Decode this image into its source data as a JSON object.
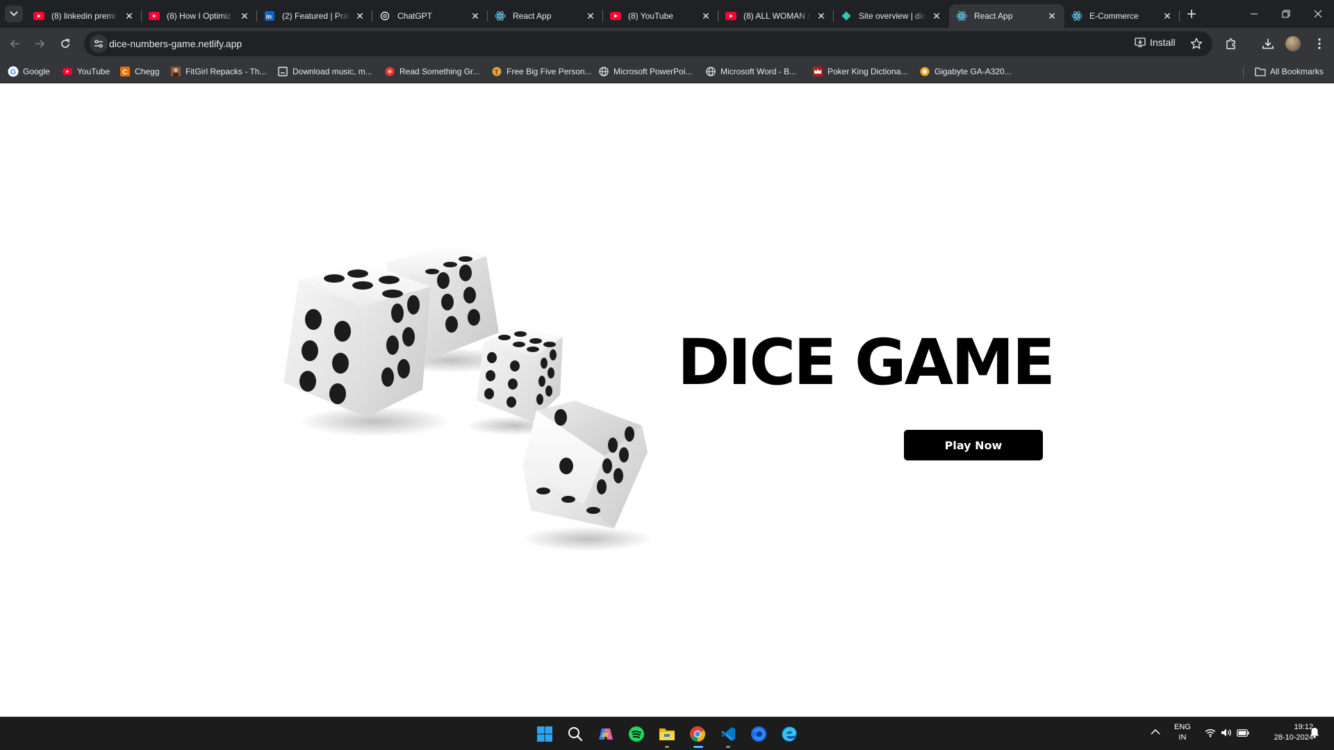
{
  "browser": {
    "tabs": [
      {
        "title": "(8) linkedin premi",
        "favicon": "youtube-icon"
      },
      {
        "title": "(8) How I Optimiz",
        "favicon": "youtube-icon"
      },
      {
        "title": "(2) Featured | Prat",
        "favicon": "linkedin-icon"
      },
      {
        "title": "ChatGPT",
        "favicon": "chatgpt-icon"
      },
      {
        "title": "React App",
        "favicon": "react-icon"
      },
      {
        "title": "(8) YouTube",
        "favicon": "youtube-icon"
      },
      {
        "title": "(8) ALL WOMAN /",
        "favicon": "youtube-icon"
      },
      {
        "title": "Site overview | dic",
        "favicon": "netlify-icon"
      },
      {
        "title": "React App",
        "favicon": "react-icon",
        "active": true
      },
      {
        "title": "E-Commerce",
        "favicon": "react-icon"
      }
    ],
    "url": "dice-numbers-game.netlify.app",
    "install_label": "Install",
    "bookmarks": [
      {
        "label": "Google",
        "icon": "google-icon"
      },
      {
        "label": "YouTube",
        "icon": "youtube-icon"
      },
      {
        "label": "Chegg",
        "icon": "chegg-icon"
      },
      {
        "label": "FitGirl Repacks - Th...",
        "icon": "fitgirl-icon"
      },
      {
        "label": "Download music, m...",
        "icon": "download-site-icon"
      },
      {
        "label": "Read Something Gr...",
        "icon": "read-site-icon"
      },
      {
        "label": "Free Big Five Person...",
        "icon": "test-site-icon"
      },
      {
        "label": "Microsoft PowerPoi...",
        "icon": "globe-icon"
      },
      {
        "label": "Microsoft Word - B...",
        "icon": "globe-icon"
      },
      {
        "label": "Poker King Dictiona...",
        "icon": "crown-icon"
      },
      {
        "label": "Gigabyte GA-A320...",
        "icon": "gigabyte-icon"
      }
    ],
    "all_bookmarks_label": "All Bookmarks"
  },
  "page": {
    "headline": "DICE GAME",
    "play_button": "Play Now",
    "image": "dice-illustration"
  },
  "taskbar": {
    "apps": [
      "windows-start-icon",
      "search-icon",
      "copilot-icon",
      "spotify-icon",
      "file-explorer-icon",
      "chrome-icon",
      "vscode-icon",
      "firefox-icon",
      "edge-icon"
    ],
    "lang_line1": "ENG",
    "lang_line2": "IN",
    "time": "19:12",
    "date": "28-10-2024"
  },
  "colors": {
    "tab_bg": "#202124",
    "toolbar_bg": "#35363a",
    "button_bg": "#000000",
    "taskbar_bg": "#1c1c1c",
    "accent_indicator": "#4cc2ff"
  }
}
